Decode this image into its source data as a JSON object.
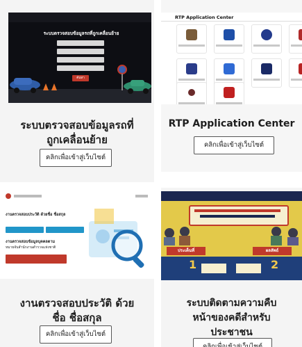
{
  "cards": [
    {
      "title_line1": "ระบบตรวจสอบข้อมูลรถที่",
      "title_line2": "ถูกเคลื่อนย้าย",
      "button": "คลิกเพื่อเข้าสู่เว็บไซต์",
      "thumb_heading": "ระบบตรวจสอบข้อมูลรถที่ถูกเคลื่อนย้าย",
      "thumb_button": "ค้นหา"
    },
    {
      "title": "RTP Application Center",
      "button": "คลิกเพื่อเข้าสู่เว็บไซต์",
      "thumb_heading": "RTP Application Center"
    },
    {
      "title_line1": "งานตรวจสอบประวัติ ด้วย",
      "title_line2": "ชื่อ ชื่อสกุล",
      "button": "คลิกเพื่อเข้าสู่เว็บไซต์",
      "thumb_line1": "งานตรวจสอบประวัติ ด้วยชื่อ ชื่อสกุล",
      "thumb_line2": "งานตรวจสอบข้อมูลบุคคลตาม",
      "thumb_line3": "หมายจับสำนักงานตำรวจแห่งชาติ"
    },
    {
      "title_line1": "ระบบติดตามความคืบ",
      "title_line2": "หน้าของคดีสำหรับ",
      "title_line3": "ประชาชน",
      "button": "คลิกเพื่อเข้าสู่เว็บไซต์",
      "thumb_tab1": "ประเด็นที่",
      "thumb_tab2": "ผลลัพธ์",
      "thumb_num1": "1",
      "thumb_num2": "2"
    }
  ],
  "colors": {
    "accent_red": "#c0392b",
    "dark": "#0d0e13",
    "banner_yellow": "#e3c94a",
    "btn_blue": "#2196c9"
  }
}
